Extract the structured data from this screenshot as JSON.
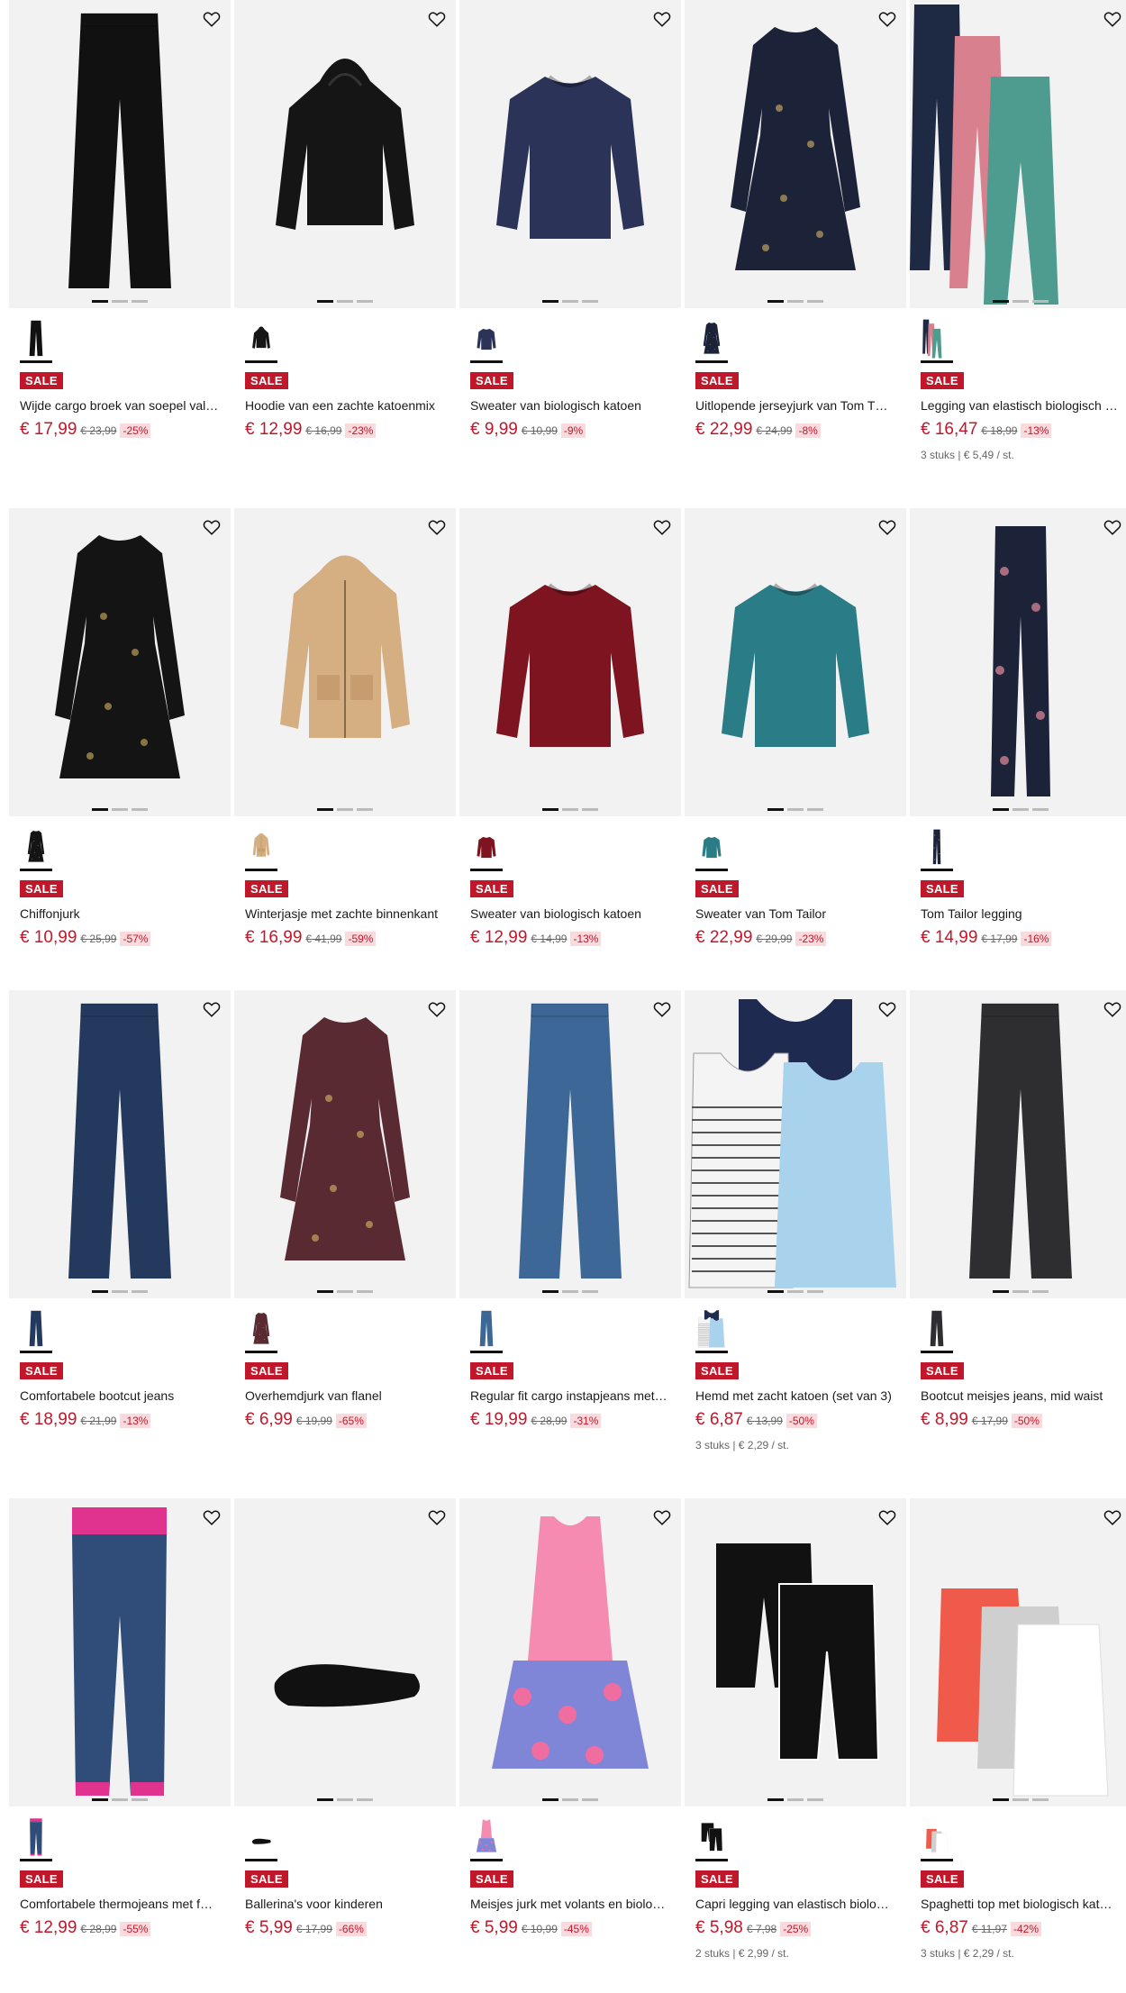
{
  "sale_label": "SALE",
  "products": [
    {
      "title": "Wijde cargo broek van soepel vall…",
      "price": "€ 17,99",
      "old": "€ 23,99",
      "disc": "-25%",
      "extra": "",
      "shape": "pants",
      "color": "#111111"
    },
    {
      "title": "Hoodie van een zachte katoenmix",
      "price": "€ 12,99",
      "old": "€ 16,99",
      "disc": "-23%",
      "extra": "",
      "shape": "hoodie",
      "color": "#151515"
    },
    {
      "title": "Sweater van biologisch katoen",
      "price": "€ 9,99",
      "old": "€ 10,99",
      "disc": "-9%",
      "extra": "",
      "shape": "sweater",
      "color": "#2b3358"
    },
    {
      "title": "Uitlopende jerseyjurk van Tom T…",
      "price": "€ 22,99",
      "old": "€ 24,99",
      "disc": "-8%",
      "extra": "",
      "shape": "dress",
      "color": "#1c2338"
    },
    {
      "title": "Legging van elastisch biologisch …",
      "price": "€ 16,47",
      "old": "€ 18,99",
      "disc": "-13%",
      "extra": "3 stuks | € 5,49 / st.",
      "shape": "leggings3",
      "color": "#1e2a44"
    },
    {
      "title": "Chiffonjurk",
      "price": "€ 10,99",
      "old": "€ 25,99",
      "disc": "-57%",
      "extra": "",
      "shape": "dress",
      "color": "#141414"
    },
    {
      "title": "Winterjasje met zachte binnenkant",
      "price": "€ 16,99",
      "old": "€ 41,99",
      "disc": "-59%",
      "extra": "",
      "shape": "jacket",
      "color": "#d5ae82"
    },
    {
      "title": "Sweater van biologisch katoen",
      "price": "€ 12,99",
      "old": "€ 14,99",
      "disc": "-13%",
      "extra": "",
      "shape": "sweater",
      "color": "#7d1420"
    },
    {
      "title": "Sweater van Tom Tailor",
      "price": "€ 22,99",
      "old": "€ 29,99",
      "disc": "-23%",
      "extra": "",
      "shape": "sweater",
      "color": "#2a7c86"
    },
    {
      "title": "Tom Tailor legging",
      "price": "€ 14,99",
      "old": "€ 17,99",
      "disc": "-16%",
      "extra": "",
      "shape": "legging",
      "color": "#1c2338"
    },
    {
      "title": "Comfortabele bootcut jeans",
      "price": "€ 18,99",
      "old": "€ 21,99",
      "disc": "-13%",
      "extra": "",
      "shape": "pants",
      "color": "#233a5e"
    },
    {
      "title": "Overhemdjurk van flanel",
      "price": "€ 6,99",
      "old": "€ 19,99",
      "disc": "-65%",
      "extra": "",
      "shape": "dress",
      "color": "#5a2a32"
    },
    {
      "title": "Regular fit cargo instapjeans met …",
      "price": "€ 19,99",
      "old": "€ 28,99",
      "disc": "-31%",
      "extra": "",
      "shape": "pants",
      "color": "#3c6796"
    },
    {
      "title": "Hemd met zacht katoen (set van 3)",
      "price": "€ 6,87",
      "old": "€ 13,99",
      "disc": "-50%",
      "extra": "3 stuks | € 2,29 / st.",
      "shape": "tanks",
      "color": "#a9d3ec"
    },
    {
      "title": "Bootcut meisjes jeans, mid waist",
      "price": "€ 8,99",
      "old": "€ 17,99",
      "disc": "-50%",
      "extra": "",
      "shape": "pants",
      "color": "#2e2e30"
    },
    {
      "title": "Comfortabele thermojeans met f…",
      "price": "€ 12,99",
      "old": "€ 28,99",
      "disc": "-55%",
      "extra": "",
      "shape": "jeanspink",
      "color": "#2f4d78"
    },
    {
      "title": "Ballerina's voor kinderen",
      "price": "€ 5,99",
      "old": "€ 17,99",
      "disc": "-66%",
      "extra": "",
      "shape": "shoe",
      "color": "#111111"
    },
    {
      "title": "Meisjes jurk met volants en biolo…",
      "price": "€ 5,99",
      "old": "€ 10,99",
      "disc": "-45%",
      "extra": "",
      "shape": "frill",
      "color": "#f58bb0"
    },
    {
      "title": "Capri legging van elastisch biolog…",
      "price": "€ 5,98",
      "old": "€ 7,98",
      "disc": "-25%",
      "extra": "2 stuks | € 2,99 / st.",
      "shape": "capri",
      "color": "#111111"
    },
    {
      "title": "Spaghetti top met biologisch kat…",
      "price": "€ 6,87",
      "old": "€ 11,97",
      "disc": "-42%",
      "extra": "3 stuks | € 2,29 / st.",
      "shape": "camis",
      "color": "#f05a4a"
    }
  ]
}
